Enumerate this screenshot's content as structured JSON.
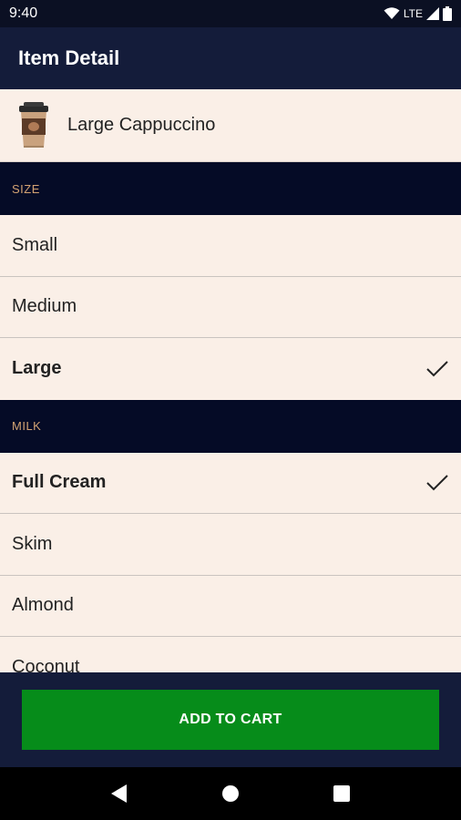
{
  "status_bar": {
    "time": "9:40",
    "network": "LTE"
  },
  "app_bar": {
    "title": "Item Detail"
  },
  "item": {
    "name": "Large Cappuccino",
    "icon": "coffee-cup-icon"
  },
  "sections": {
    "size": {
      "label": "SIZE",
      "options": [
        {
          "label": "Small",
          "selected": false
        },
        {
          "label": "Medium",
          "selected": false
        },
        {
          "label": "Large",
          "selected": true
        }
      ]
    },
    "milk": {
      "label": "MILK",
      "options": [
        {
          "label": "Full Cream",
          "selected": true
        },
        {
          "label": "Skim",
          "selected": false
        },
        {
          "label": "Almond",
          "selected": false
        },
        {
          "label": "Coconut",
          "selected": false
        }
      ]
    }
  },
  "actions": {
    "add_to_cart": "ADD TO CART"
  },
  "colors": {
    "app_bar": "#141c3a",
    "section_header": "#050b26",
    "section_label": "#d4a373",
    "row_background": "#faefe7",
    "primary_button": "#068c1a"
  }
}
